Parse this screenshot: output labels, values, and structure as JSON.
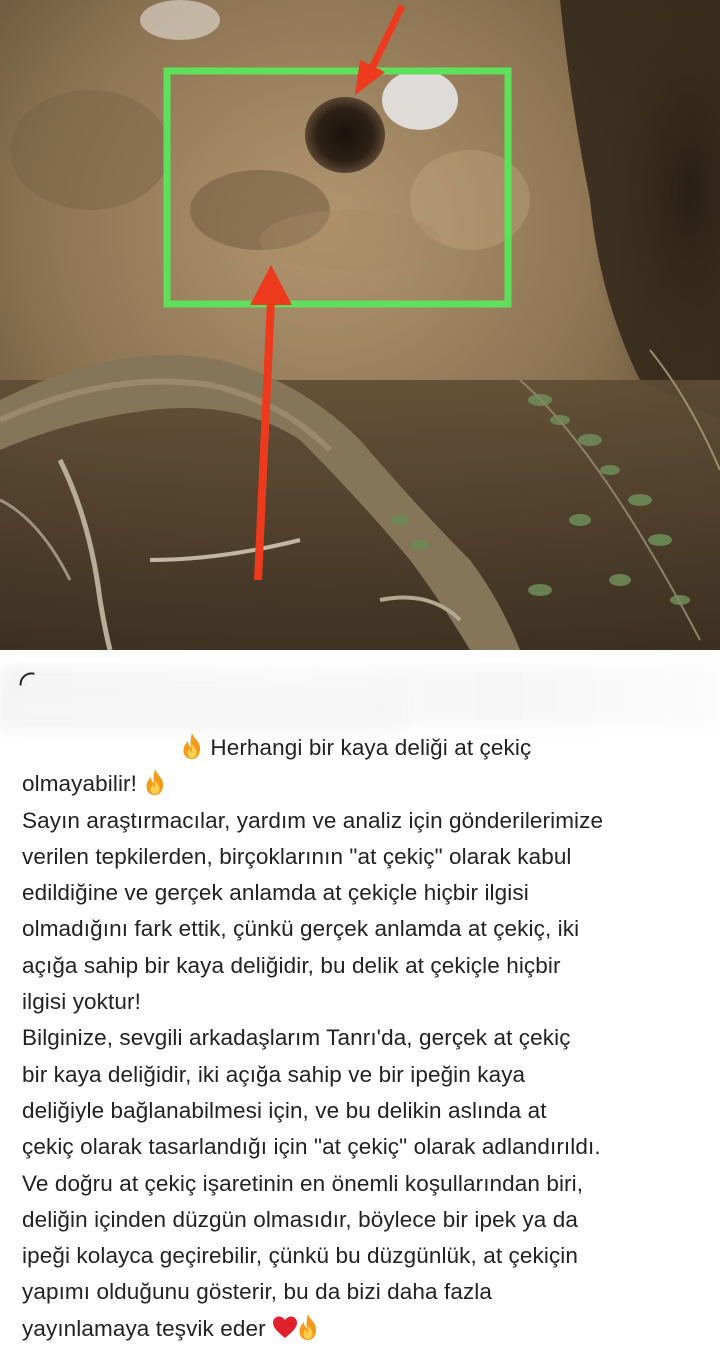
{
  "post": {
    "title_line_1": "Herhangi bir kaya deliği at çekiç",
    "title_line_2": "olmayabilir!",
    "body_lines": [
      "Sayın araştırmacılar, yardım ve analiz için gönderilerimize",
      "verilen tepkilerden, birçoklarının \"at çekiç\" olarak kabul",
      "edildiğine ve gerçek anlamda at çekiçle hiçbir ilgisi",
      "olmadığını fark ettik, çünkü gerçek anlamda at çekiç, iki",
      "açığa sahip bir kaya deliğidir, bu delik at çekiçle hiçbir",
      "ilgisi yoktur!",
      "Bilginize, sevgili arkadaşlarım Tanrı'da, gerçek at çekiç",
      "bir kaya deliğidir, iki açığa sahip ve bir ipeğin kaya",
      "deliğiyle bağlanabilmesi için, ve bu delikin aslında at",
      "çekiç olarak tasarlandığı için \"at çekiç\" olarak adlandırıldı.",
      "Ve doğru at çekiç işaretinin en önemli koşullarından biri,",
      "deliğin içinden düzgün olmasıdır, böylece bir ipek ya da",
      "ipeği kolayca geçirebilir, çünkü bu düzgünlük, at çekiçin",
      "yapımı olduğunu gösterir, bu da bizi daha fazla"
    ],
    "last_line": "yayınlamaya teşvik eder"
  },
  "icons": {
    "fire": "fire-emoji-icon",
    "heart": "red-heart-emoji-icon"
  },
  "colors": {
    "highlight_box": "#5ee05a",
    "arrow": "#ee3a1c",
    "text": "#222222"
  }
}
